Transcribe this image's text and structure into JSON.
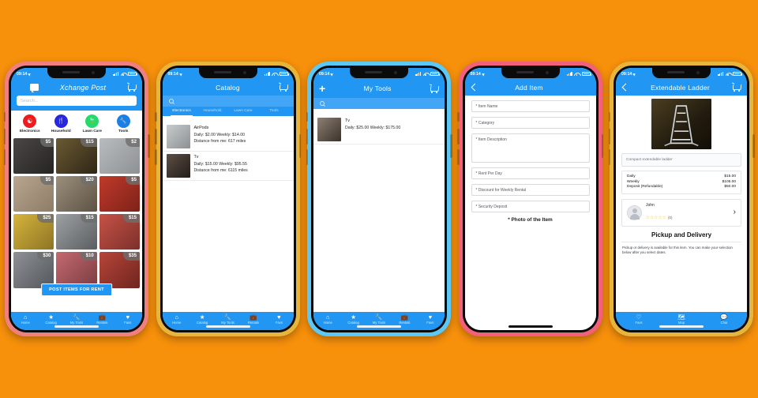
{
  "background_color": "#F7900B",
  "theme": {
    "primary": "#2196F3",
    "accent_light": "#42A5F5",
    "star": "#F2C230"
  },
  "status_bar": {
    "time": "09:14"
  },
  "phones": [
    {
      "frame_color": "#F08080",
      "name": "home-screen",
      "app_bar": {
        "logo": "Xchange Post",
        "menu_icon": "hamburger-icon",
        "chat_icon": "chat-icon",
        "cart_icon": "cart-icon"
      },
      "search": {
        "placeholder": "Search..."
      },
      "categories": [
        {
          "label": "Electronics",
          "color": "#EE1C1C",
          "glyph": "⏿"
        },
        {
          "label": "Household",
          "color": "#2727DD",
          "glyph": "🍴"
        },
        {
          "label": "Lawn Care",
          "color": "#27D86B",
          "glyph": "🍃"
        },
        {
          "label": "Tools",
          "color": "#1C7FE8",
          "glyph": "🔧"
        }
      ],
      "grid_items": [
        {
          "price": "$5",
          "c1": "#4a4745",
          "c2": "#262422"
        },
        {
          "price": "$15",
          "c1": "#6b5a33",
          "c2": "#2e2616"
        },
        {
          "price": "$2",
          "c1": "#b9bcbe",
          "c2": "#8e9194"
        },
        {
          "price": "$5",
          "c1": "#b8a68f",
          "c2": "#8d7c66"
        },
        {
          "price": "$20",
          "c1": "#9b8f7c",
          "c2": "#5d5344"
        },
        {
          "price": "$5",
          "c1": "#c0392b",
          "c2": "#7e2218"
        },
        {
          "price": "$25",
          "c1": "#d6b43c",
          "c2": "#8d7425"
        },
        {
          "price": "$15",
          "c1": "#9da1a4",
          "c2": "#5a5e61"
        },
        {
          "price": "$15",
          "c1": "#c75247",
          "c2": "#7b302a"
        },
        {
          "price": "$30",
          "c1": "#8e9296",
          "c2": "#53575b"
        },
        {
          "price": "$10",
          "c1": "#c46a70",
          "c2": "#7a3c41"
        },
        {
          "price": "$35",
          "c1": "#b7453a",
          "c2": "#6f251e"
        }
      ],
      "post_button": "POST ITEMS FOR RENT",
      "bottom_nav": [
        {
          "label": "Home",
          "icon": "home-icon",
          "glyph": "⌂"
        },
        {
          "label": "Catalog",
          "icon": "star-icon",
          "glyph": "★"
        },
        {
          "label": "My Tools",
          "icon": "wrench-icon",
          "glyph": "🔧"
        },
        {
          "label": "Rentals",
          "icon": "briefcase-icon",
          "glyph": "💼"
        },
        {
          "label": "Favs",
          "icon": "heart-icon",
          "glyph": "♥"
        }
      ]
    },
    {
      "frame_color": "#E8B53C",
      "name": "catalog-screen",
      "app_bar": {
        "title": "Catalog",
        "cart_icon": "cart-icon"
      },
      "filter_tabs": [
        {
          "label": "Electronics",
          "active": true
        },
        {
          "label": "Household",
          "active": false
        },
        {
          "label": "Lawn Care",
          "active": false
        },
        {
          "label": "Tools",
          "active": false
        }
      ],
      "items": [
        {
          "title": "AirPods",
          "pricing": "Daily: $2.00   Weekly: $14.00",
          "distance": "Distance from me: 617 miles",
          "c1": "#c9cccd",
          "c2": "#8d9092"
        },
        {
          "title": "Tv",
          "pricing": "Daily: $15.00   Weekly: $95.55",
          "distance": "Distance from me: 6115 miles",
          "c1": "#5d4f45",
          "c2": "#221c18"
        }
      ],
      "bottom_nav": [
        {
          "label": "Home",
          "glyph": "⌂"
        },
        {
          "label": "Catalog",
          "glyph": "★"
        },
        {
          "label": "My Tools",
          "glyph": "🔧"
        },
        {
          "label": "Rentals",
          "glyph": "💼"
        },
        {
          "label": "Favs",
          "glyph": "♥"
        }
      ]
    },
    {
      "frame_color": "#5BC8F5",
      "name": "my-tools-screen",
      "app_bar": {
        "title": "My Tools",
        "add_icon": "plus-icon",
        "cart_icon": "cart-icon"
      },
      "items": [
        {
          "title": "Tv",
          "pricing": "Daily: $25.00   Weekly: $175.00",
          "c1": "#8d7f72",
          "c2": "#3b322b"
        }
      ],
      "bottom_nav": [
        {
          "label": "Home",
          "glyph": "⌂"
        },
        {
          "label": "Catalog",
          "glyph": "★"
        },
        {
          "label": "My Tools",
          "glyph": "🔧"
        },
        {
          "label": "Rentals",
          "glyph": "💼"
        },
        {
          "label": "Favs",
          "glyph": "♥"
        }
      ]
    },
    {
      "frame_color": "#F2607A",
      "name": "add-item-screen",
      "app_bar": {
        "title": "Add Item",
        "back_icon": "back-chevron-icon"
      },
      "fields": [
        {
          "label": "* Item Name",
          "size": "h1"
        },
        {
          "label": "* Category",
          "size": "h1"
        },
        {
          "label": "* Item Description",
          "size": "tall"
        },
        {
          "label": "* Rent Per Day",
          "size": "h1"
        },
        {
          "label": "* Discount for Weekly Rental",
          "size": "h1"
        },
        {
          "label": "* Security Deposit",
          "size": "h1"
        }
      ],
      "photo_label": "* Photo of the Item"
    },
    {
      "frame_color": "#E8B53C",
      "name": "item-detail-screen",
      "app_bar": {
        "title": "Extendable Ladder",
        "back_icon": "back-chevron-icon",
        "cart_icon": "cart-icon"
      },
      "description": "Compact extendable ladder",
      "pricing": [
        {
          "label": "Daily",
          "value": "$15.00"
        },
        {
          "label": "Weekly",
          "value": "$105.00"
        },
        {
          "label": "Deposit (Refundable)",
          "value": "$50.00"
        }
      ],
      "owner": {
        "name": "John",
        "stars": "☆☆☆☆☆",
        "rating_count": "(0)"
      },
      "section_title": "Pickup and Delivery",
      "note": "Pickup or delivery is available for this item. You can make your selection below after you select dates.",
      "bottom_nav": [
        {
          "label": "Favs",
          "glyph": "♡"
        },
        {
          "label": "Map",
          "glyph": "🗺"
        },
        {
          "label": "Chat",
          "glyph": "💬"
        }
      ]
    }
  ]
}
